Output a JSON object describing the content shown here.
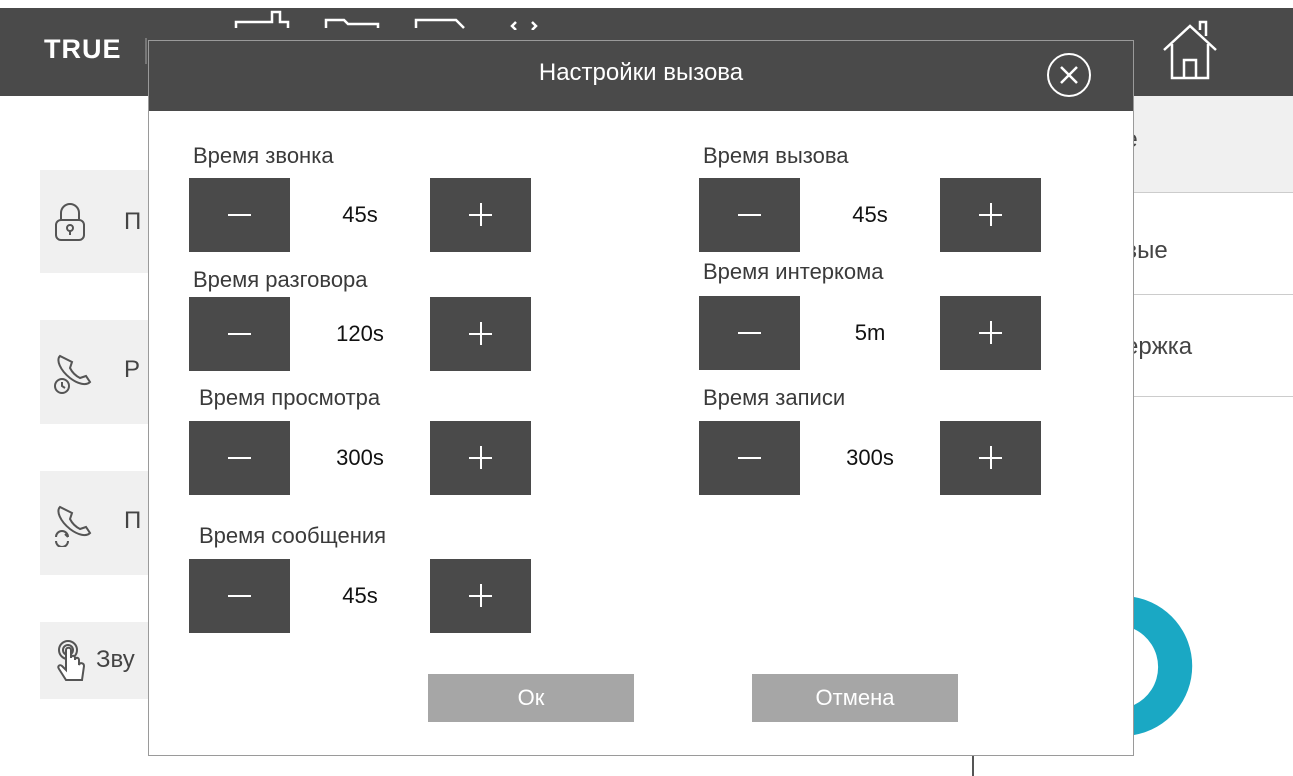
{
  "app": {
    "logo": "TRUE"
  },
  "background_left_menu": [
    {
      "label": "П",
      "icon": "lock-icon"
    },
    {
      "label": "Р",
      "icon": "clock-phone-icon"
    },
    {
      "label": "П",
      "icon": "redirect-phone-icon"
    },
    {
      "label": "Зву",
      "icon": "touch-icon"
    }
  ],
  "background_right_menu": [
    {
      "label": "ие"
    },
    {
      "label": "евые"
    },
    {
      "label": "держка"
    }
  ],
  "modal": {
    "title": "Настройки вызова",
    "fields": [
      {
        "label": "Время звонка",
        "value": "45s"
      },
      {
        "label": "Время вызова",
        "value": "45s"
      },
      {
        "label": "Время разговора",
        "value": "120s"
      },
      {
        "label": "Время интеркома",
        "value": "5m"
      },
      {
        "label": "Время просмотра",
        "value": "300s"
      },
      {
        "label": "Время записи",
        "value": "300s"
      },
      {
        "label": "Время сообщения",
        "value": "45s"
      }
    ],
    "ok_label": "Ок",
    "cancel_label": "Отмена"
  },
  "colors": {
    "header": "#4a4a4a",
    "stepper_button": "#4a4a4a",
    "dialog_button": "#a6a6a6",
    "accent": "#1aa8c4"
  }
}
